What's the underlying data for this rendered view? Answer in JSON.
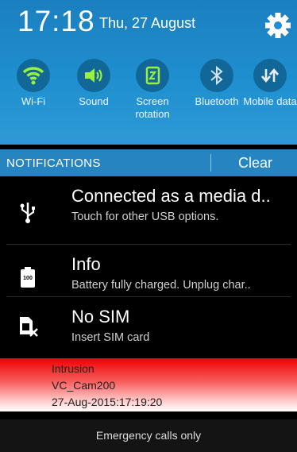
{
  "status": {
    "time": "17:18",
    "date": "Thu, 27 August"
  },
  "quick_settings": [
    {
      "label": "Wi-Fi",
      "icon": "wifi-icon"
    },
    {
      "label": "Sound",
      "icon": "speaker-icon"
    },
    {
      "label": "Screen rotation",
      "icon": "rotation-icon"
    },
    {
      "label": "Bluetooth",
      "icon": "bluetooth-icon"
    },
    {
      "label": "Mobile data",
      "icon": "mobile-data-icon"
    }
  ],
  "notifications": {
    "header": "NOTIFICATIONS",
    "clear_label": "Clear",
    "items": [
      {
        "title": "Connected as a media d..",
        "subtitle": "Touch for other USB options.",
        "icon": "usb-icon"
      },
      {
        "title": "Info",
        "subtitle": "Battery fully charged. Unplug char..",
        "icon": "battery-icon",
        "battery_label": "100"
      },
      {
        "title": "No SIM",
        "subtitle": "Insert SIM card",
        "icon": "no-sim-icon"
      }
    ]
  },
  "alert": {
    "line1": "Intrusion",
    "line2": "VC_Cam200",
    "line3": "27-Aug-2015:17:19:20",
    "color": "#f00000"
  },
  "footer": {
    "text": "Emergency calls only"
  },
  "colors": {
    "header": "#1f8fcf",
    "toggle_bg": "#116898",
    "toggle_on": "#9bf03c",
    "notif_bar": "#2685c1"
  }
}
